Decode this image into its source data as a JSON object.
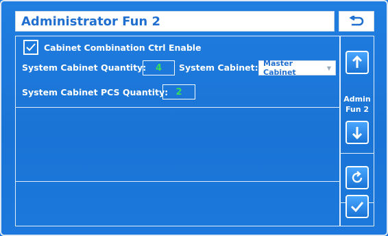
{
  "title": "Administrator Fun 2",
  "options": {
    "combo_label": "Cabinet Combination Ctrl Enable",
    "combo_checked": true,
    "qty_label": "System Cabinet Quantity:",
    "qty_value": "4",
    "cabinet_label": "System Cabinet:",
    "cabinet_selected": "Master Cabinet",
    "pcs_label": "System Cabinet PCS Quantity:",
    "pcs_value": "2"
  },
  "side": {
    "label_line1": "Admin",
    "label_line2": "Fun 2"
  },
  "icons": {
    "back": "back-arrow-icon",
    "up": "arrow-up-icon",
    "down": "arrow-down-icon",
    "refresh": "refresh-icon",
    "confirm": "checkmark-icon",
    "check": "checkmark-icon",
    "caret": "caret-down-icon"
  },
  "colors": {
    "background": "#1a74d6",
    "title_text": "#1f6fd0",
    "value_text": "#36e05a"
  }
}
